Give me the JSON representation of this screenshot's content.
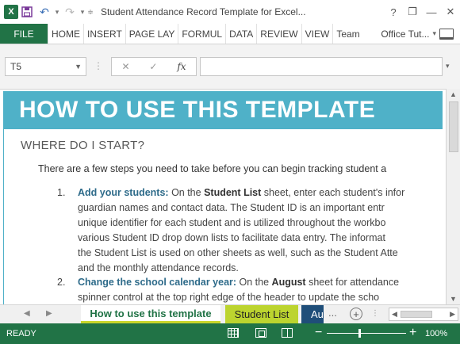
{
  "titlebar": {
    "app_logo": "X",
    "title": "Student Attendance Record Template for Excel...",
    "help_glyph": "?",
    "minimize_glyph": "—",
    "restore_glyph": "❐",
    "close_glyph": "✕"
  },
  "ribbon": {
    "file_label": "FILE",
    "tabs": [
      "HOME",
      "INSERT",
      "PAGE LAY",
      "FORMUL",
      "DATA",
      "REVIEW",
      "VIEW",
      "Team"
    ],
    "account_name": "Office Tut..."
  },
  "formula_bar": {
    "name_box": "T5",
    "cancel_glyph": "✕",
    "enter_glyph": "✓",
    "fx_label": "fx",
    "formula_value": ""
  },
  "sheet": {
    "header_title": "HOW TO USE THIS TEMPLATE",
    "section_heading": "WHERE DO I START?",
    "intro": "There are a few steps you need to take before you can begin tracking student a",
    "step1": {
      "num": "1.",
      "title": "Add your students:",
      "l1_a": " On the ",
      "l1_b": "Student List",
      "l1_c": " sheet, enter each student's infor",
      "l2": "guardian names and contact data. The Student ID is an important entr",
      "l3": "unique identifier for each student and is utilized throughout the workbo",
      "l4": "various Student ID drop down lists to facilitate data entry. The informat",
      "l5": "the Student List is used on other sheets as well, such as the Student Atte",
      "l6": "and the monthly attendance records."
    },
    "step2": {
      "num": "2.",
      "title": "Change the school calendar year:",
      "l1_a": " On the ",
      "l1_b": "August",
      "l1_c": " sheet for attendance",
      "l2": "spinner control at the top right edge of the header to update the scho"
    }
  },
  "sheet_tabs": {
    "active": "How to use this template",
    "second": "Student List",
    "third": "Au",
    "more": "...",
    "add": "+"
  },
  "statusbar": {
    "ready": "READY",
    "zoom": "100%",
    "minus": "−",
    "plus": "+"
  },
  "colors": {
    "excel_green": "#217346",
    "header_teal": "#4fb1c8",
    "tab_lime": "#bcd42f",
    "tab_navy": "#1f4e79",
    "step_title_blue": "#2e6b8a"
  },
  "icons": [
    "excel-logo-icon",
    "save-icon",
    "undo-icon",
    "redo-icon",
    "customize-qat-icon",
    "help-icon",
    "restore-ribbon-icon",
    "minimize-icon",
    "close-icon",
    "laptop-icon",
    "fx-icon"
  ]
}
